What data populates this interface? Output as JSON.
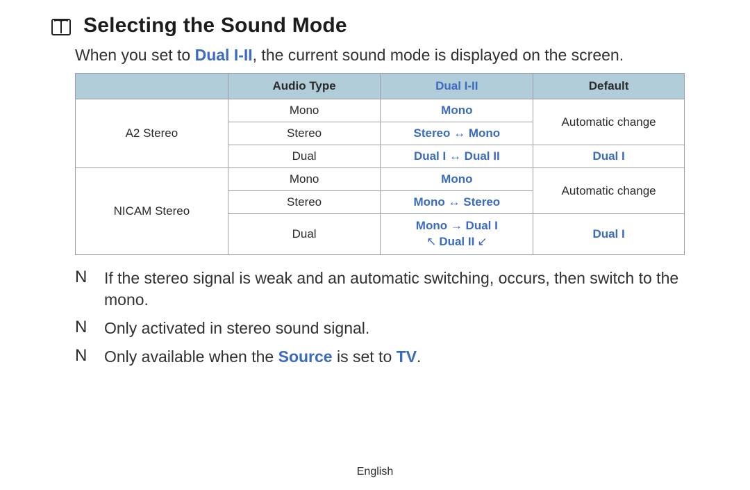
{
  "heading": "Selecting the Sound Mode",
  "intro": {
    "prefix": "When you set to ",
    "dual": "Dual I-II",
    "suffix": ", the current sound mode is displayed on the screen."
  },
  "table": {
    "headers": {
      "col1_blank": "",
      "audio_type": "Audio Type",
      "dual": "Dual I-II",
      "default": "Default"
    },
    "groups": [
      {
        "name": "A2 Stereo",
        "rows": [
          {
            "audio": "Mono",
            "dual": "Mono",
            "default": "Automatic change",
            "default_span": 2
          },
          {
            "audio": "Stereo",
            "dual": "Stereo ↔ Mono"
          },
          {
            "audio": "Dual",
            "dual": "Dual I ↔ Dual II",
            "default": "Dual I",
            "default_blue": true
          }
        ]
      },
      {
        "name": "NICAM Stereo",
        "rows": [
          {
            "audio": "Mono",
            "dual": "Mono",
            "default": "Automatic change",
            "default_span": 2
          },
          {
            "audio": "Stereo",
            "dual": "Mono ↔ Stereo"
          },
          {
            "audio": "Dual",
            "dual_cycle": {
              "line1": "Mono → Dual I",
              "line2_mid": "Dual II"
            },
            "default": "Dual I",
            "default_blue": true
          }
        ]
      }
    ]
  },
  "notes": {
    "marker": "N",
    "items": [
      {
        "text": "If the stereo signal is weak and an automatic switching, occurs, then switch to the mono."
      },
      {
        "text": "Only activated in stereo sound signal."
      },
      {
        "prefix": "Only available when the ",
        "kw1": "Source",
        "mid": " is set to ",
        "kw2": "TV",
        "suffix": "."
      }
    ]
  },
  "footer": {
    "language": "English"
  }
}
